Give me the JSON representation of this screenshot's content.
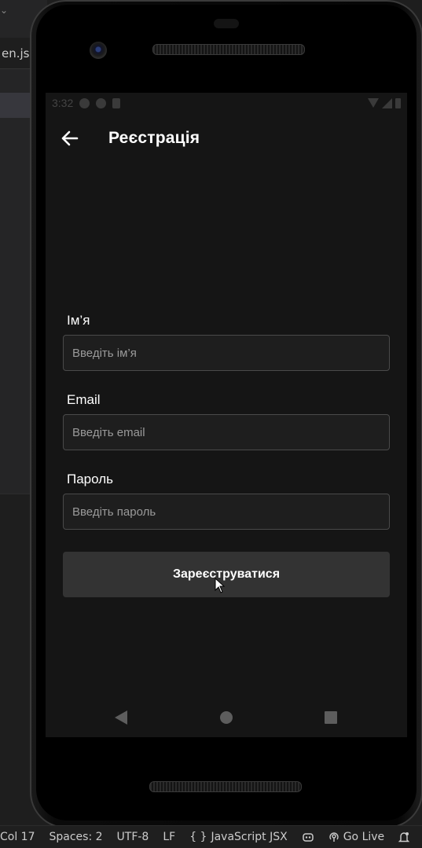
{
  "editor": {
    "tab_label": "en.jsx"
  },
  "device": {
    "status": {
      "time": "3:32"
    },
    "app": {
      "title": "Реєстрація",
      "fields": [
        {
          "label": "Ім’я",
          "placeholder": "Введіть ім’я"
        },
        {
          "label": "Email",
          "placeholder": "Введіть email"
        },
        {
          "label": "Пароль",
          "placeholder": "Введіть пароль"
        }
      ],
      "submit_label": "Зареєструватися"
    },
    "icons": {
      "back": "arrow-left-icon",
      "nav_back": "triangle-back-icon",
      "nav_home": "circle-home-icon",
      "nav_recent": "square-recents-icon"
    }
  },
  "statusbar": {
    "position": "Col 17",
    "spaces": "Spaces: 2",
    "encoding": "UTF-8",
    "eol": "LF",
    "language_icon": "{ }",
    "language": "JavaScript JSX",
    "copilot_icon": "copilot-icon",
    "golive": "Go Live",
    "bell_icon": "bell-icon"
  },
  "colors": {
    "screen_bg": "#151515",
    "button_bg": "#333333",
    "input_border": "#4a4a4a",
    "text": "#ffffff",
    "placeholder": "#9a9a9a"
  }
}
